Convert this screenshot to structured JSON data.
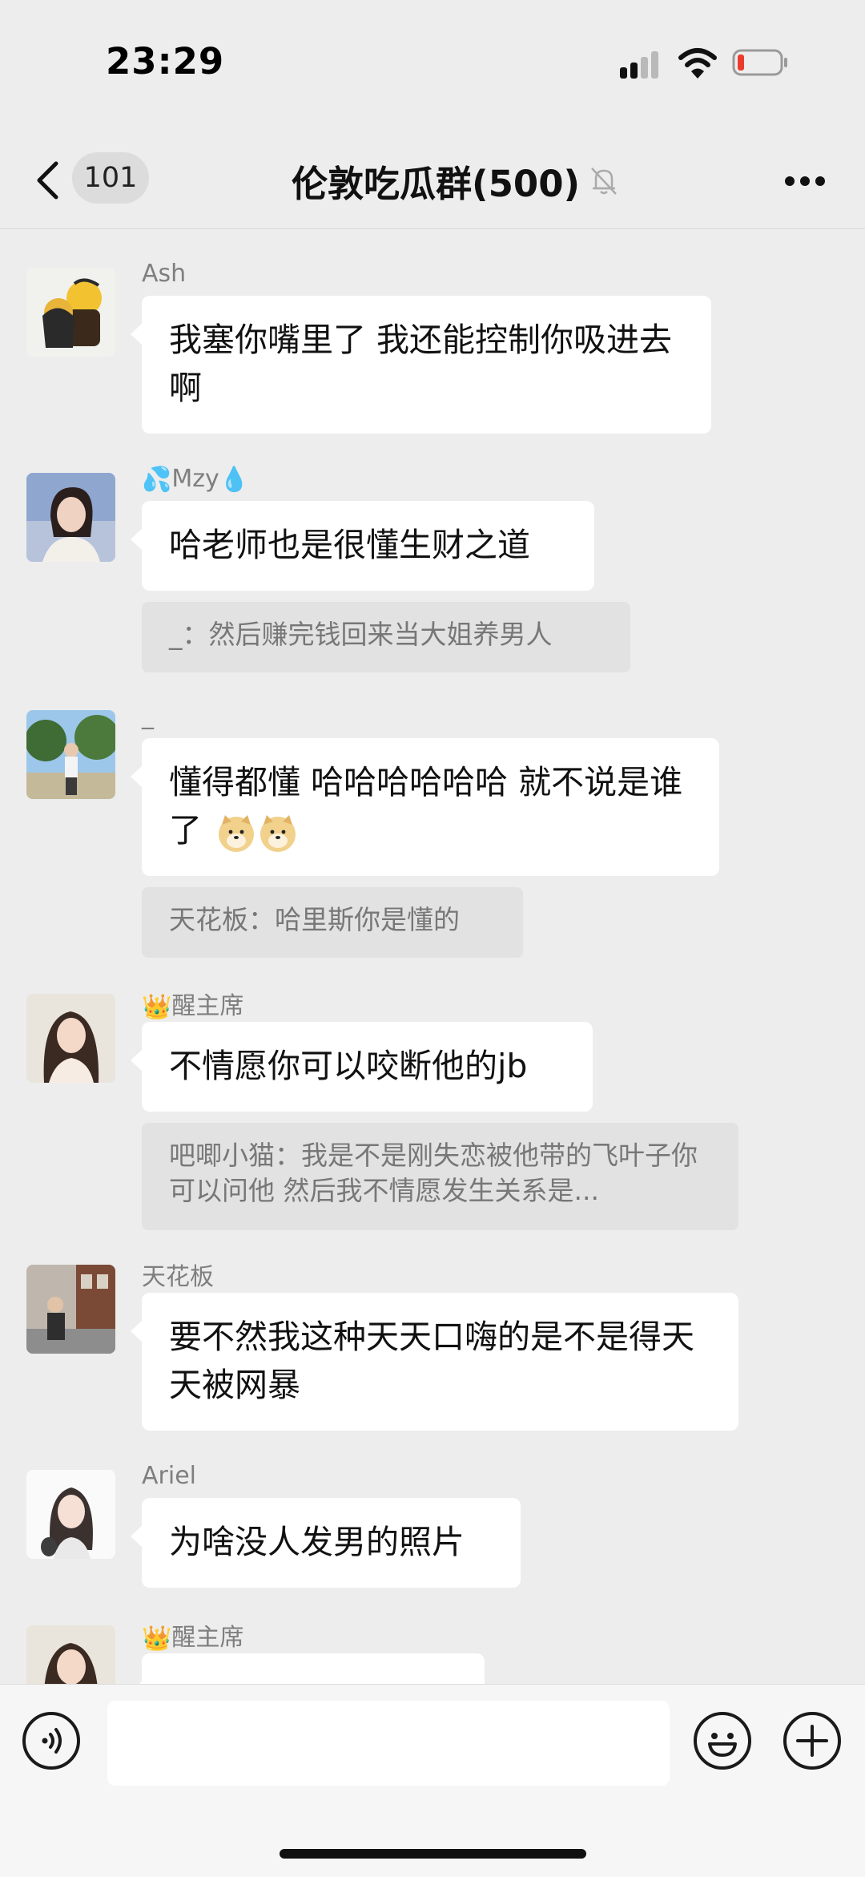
{
  "status_bar": {
    "time": "23:29"
  },
  "nav": {
    "unread_count": "101",
    "title": "伦敦吃瓜群(500)",
    "icons": [
      "chevron-left-icon",
      "bell-muted-icon",
      "more-icon"
    ]
  },
  "messages": [
    {
      "sender": "Ash",
      "text": "我塞你嘴里了 我还能控制你吸进去啊"
    },
    {
      "sender": "Mzy",
      "sender_prefix_emoji": "💦",
      "sender_suffix_emoji": "💧",
      "text": "哈老师也是很懂生财之道",
      "quote": "_：然后赚完钱回来当大姐养男人"
    },
    {
      "sender": "_",
      "text": "懂得都懂 哈哈哈哈哈哈 就不说是谁了",
      "quote": "天花板：哈里斯你是懂的"
    },
    {
      "sender": "醒主席",
      "sender_prefix_emoji": "👑",
      "text": "不情愿你可以咬断他的jb",
      "quote": "吧唧小猫：我是不是刚失恋被他带的飞叶子你可以问他 然后我不情愿发生关系是..."
    },
    {
      "sender": "天花板",
      "text": "要不然我这种天天口嗨的是不是得天天被网暴"
    },
    {
      "sender": "Ariel",
      "text": "为啥没人发男的照片"
    },
    {
      "sender": "醒主席",
      "sender_prefix_emoji": "👑",
      "text": ""
    }
  ],
  "input": {
    "placeholder": "",
    "icons": [
      "voice-icon",
      "emoji-icon",
      "plus-icon"
    ]
  },
  "colors": {
    "background": "#ededed",
    "bubble": "#ffffff",
    "quote_bg": "#e2e2e2",
    "sender_text": "#7f7f7f"
  }
}
